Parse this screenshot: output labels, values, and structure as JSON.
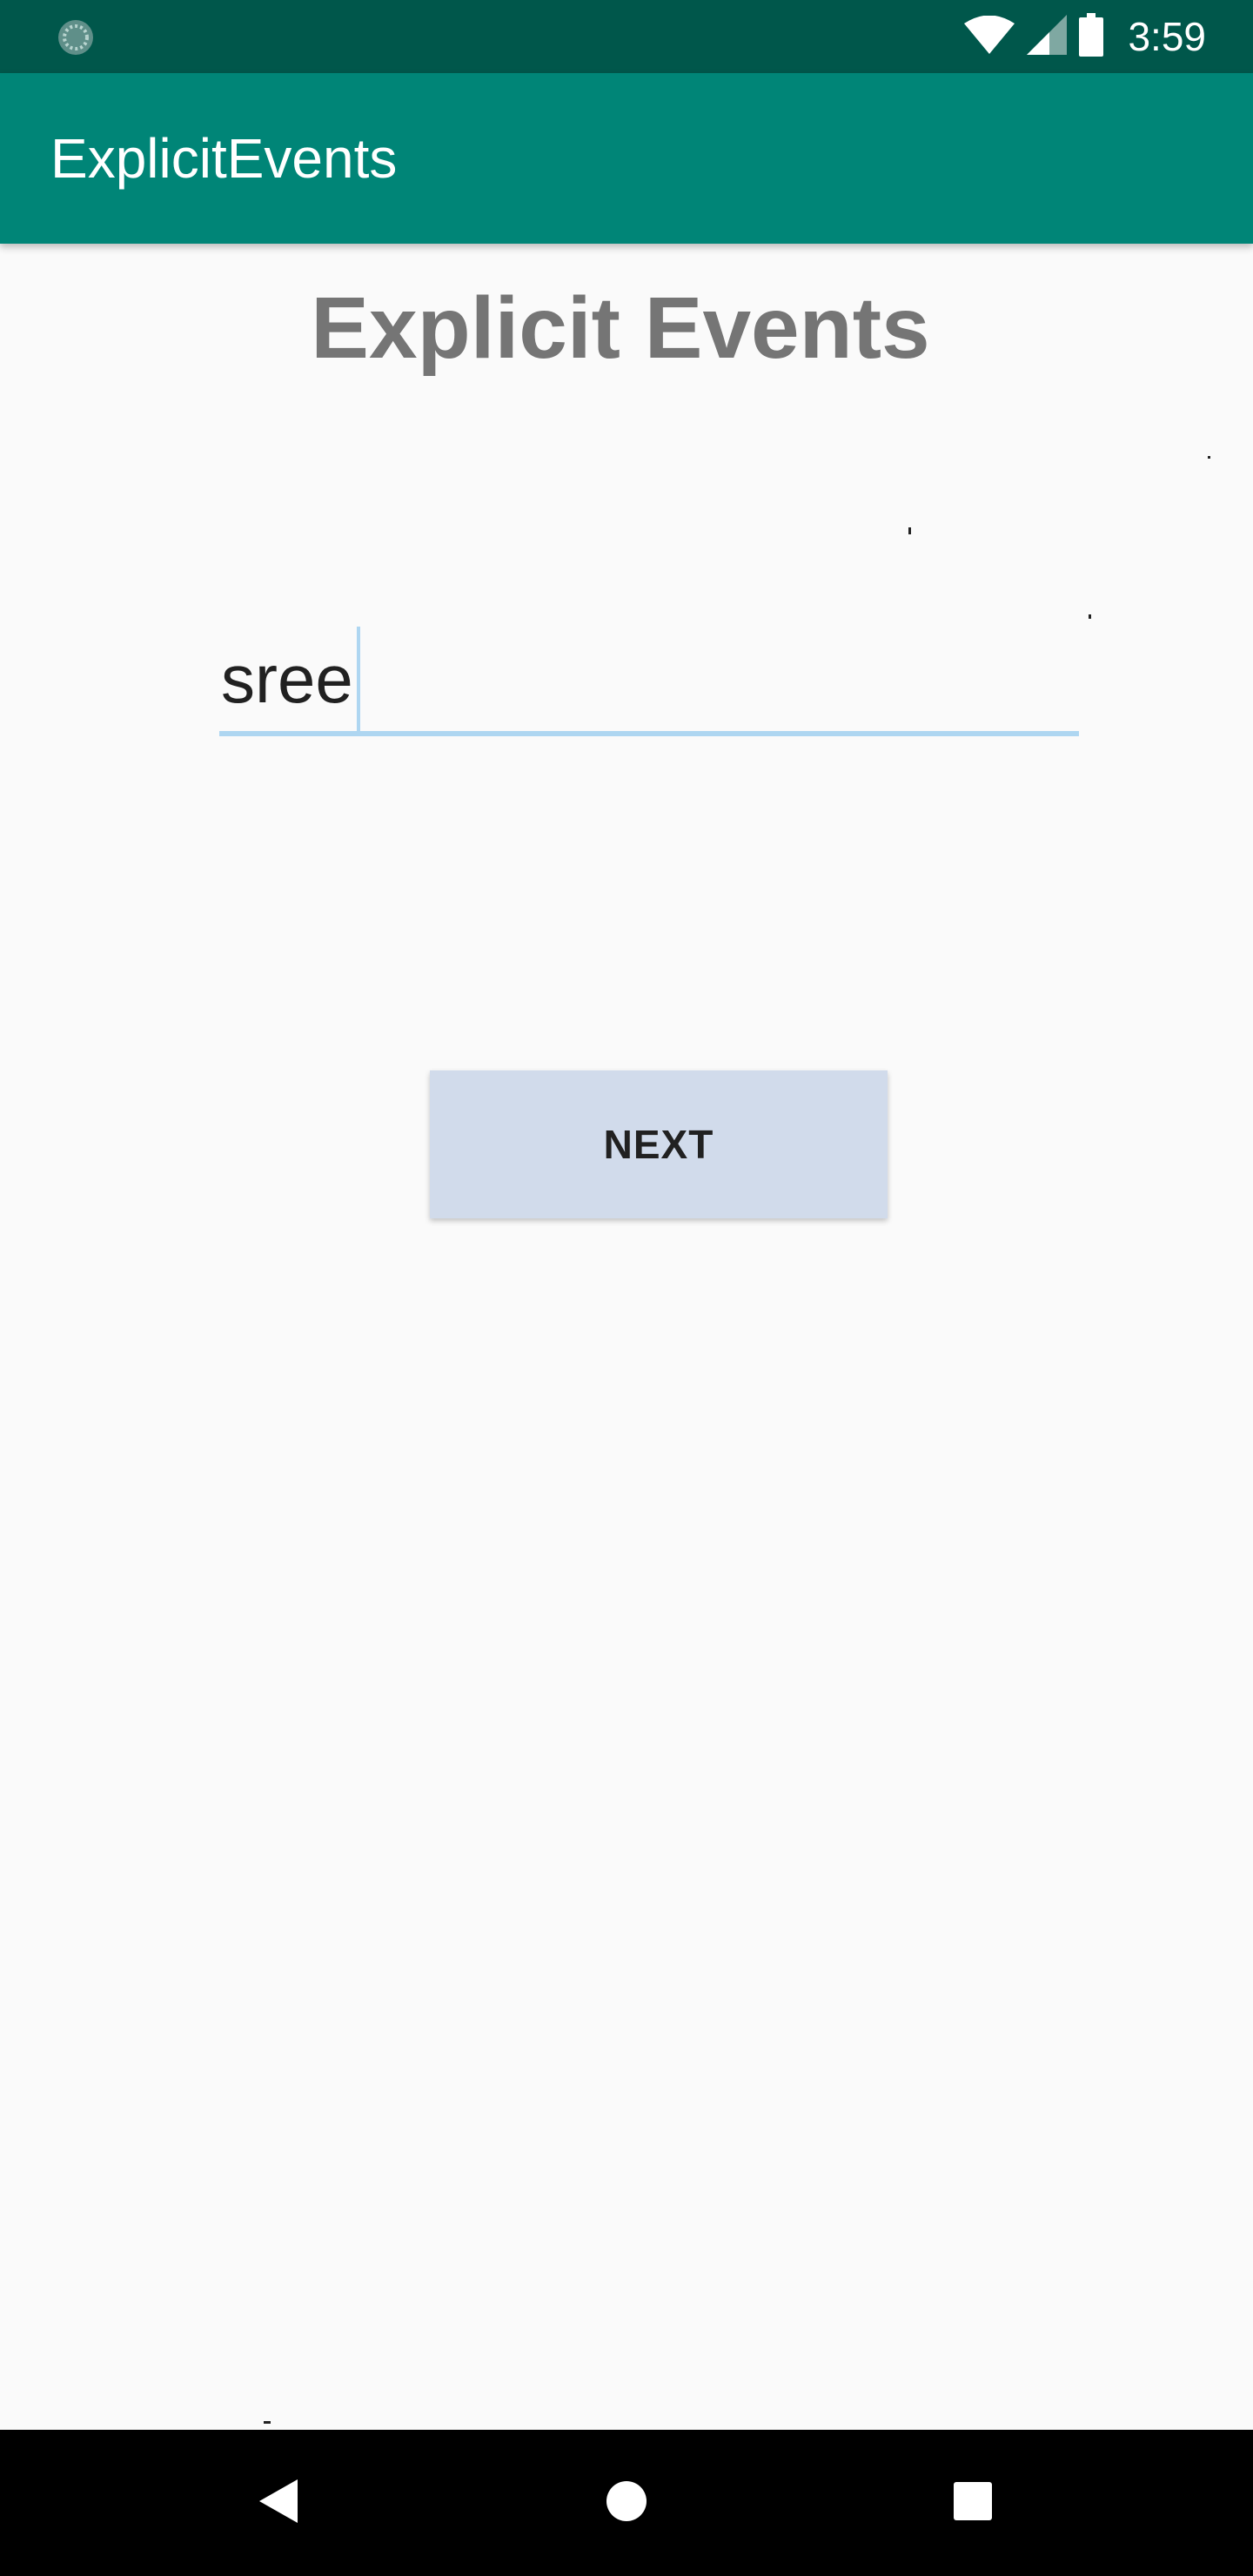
{
  "status_bar": {
    "time": "3:59",
    "left_icon": "sync-spinner-icon",
    "icons": [
      "wifi-icon",
      "cell-signal-icon",
      "battery-icon"
    ]
  },
  "app_bar": {
    "title": "ExplicitEvents",
    "color": "#008577"
  },
  "main": {
    "heading": "Explicit Events",
    "input": {
      "value": "sree"
    },
    "next_button": {
      "label": "NEXT"
    }
  },
  "nav_bar": {
    "buttons": [
      "back-icon",
      "home-icon",
      "recents-icon"
    ]
  },
  "colors": {
    "status_bar": "#00574b",
    "app_bar": "#008577",
    "accent_underline": "#aed6f1",
    "button_bg": "#d1dbeb"
  }
}
